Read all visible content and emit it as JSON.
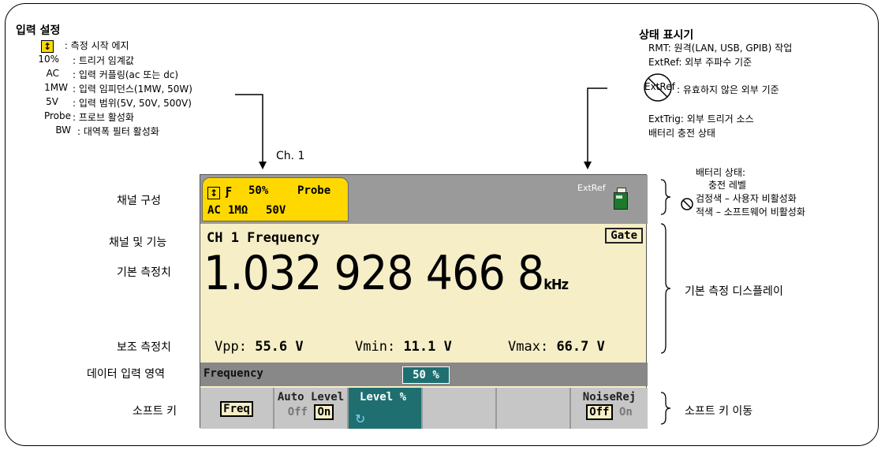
{
  "input_settings": {
    "title": "입력 설정",
    "rows": [
      {
        "key": "↕",
        "desc": ": 측정 시작 에지"
      },
      {
        "key": "10%",
        "desc": ": 트리거 임계값"
      },
      {
        "key": "AC",
        "desc": ": 입력 커플링(ac 또는 dc)"
      },
      {
        "key": "1MW",
        "desc": ": 입력 임피던스(1MW, 50W)"
      },
      {
        "key": "5V",
        "desc": ": 입력 범위(5V, 50V, 500V)"
      },
      {
        "key": "Probe",
        "desc": ": 프로브 활성화"
      },
      {
        "key": "BW",
        "desc": ": 대역폭 필터 활성화"
      }
    ]
  },
  "status_indicators": {
    "title": "상태 표시기",
    "rmt": "RMT: 원격(LAN, USB, GPIB) 작업",
    "extref": "ExtRef: 외부 주파수 기준",
    "extref_invalid_icon": "ExtRef",
    "extref_invalid": ": 유효하지 않은 외부 기준",
    "exttrig": "ExtTrig: 외부 트리거 소스",
    "battery": "배터리 충전 상태"
  },
  "battery_status": {
    "title": "배터리 상태:",
    "line1": "충전 레벨",
    "line2": "검정색 – 사용자 비활성화",
    "line3": "적색 – 소프트웨어 비활성화"
  },
  "ch1_label": "Ch. 1",
  "left_labels": {
    "channel_config": "채널 구성",
    "channel_function": "채널 및 기능",
    "primary": "기본 측정치",
    "secondary": "보조 측정치",
    "data_entry": "데이터 입력 영역",
    "softkeys": "소프트 키"
  },
  "right_labels": {
    "primary_display": "기본 측정 디스플레이",
    "softkey_nav": "소프트 키 이동"
  },
  "display": {
    "tab": {
      "slope_icon": "↕",
      "edge": "Ƒ",
      "level": "50%",
      "probe": "Probe",
      "coupling": "AC",
      "impedance": "1MΩ",
      "range": "50V"
    },
    "extref": "ExtRef",
    "function": "CH 1 Frequency",
    "gate": "Gate",
    "primary_value": "1.032 928 466 8",
    "primary_unit": "kHz",
    "secondary": [
      {
        "label": "Vpp:",
        "value": "55.6 V"
      },
      {
        "label": "Vmin:",
        "value": "11.1 V"
      },
      {
        "label": "Vmax:",
        "value": "66.7 V"
      }
    ],
    "entry_label": "Frequency",
    "entry_value": "50",
    "entry_unit": "%",
    "softkeys": {
      "freq": "Freq",
      "auto_level": "Auto Level",
      "auto_off": "Off",
      "auto_on": "On",
      "level_pct": "Level %",
      "noiserej": "NoiseRej",
      "noise_off": "Off",
      "noise_on": "On"
    }
  }
}
